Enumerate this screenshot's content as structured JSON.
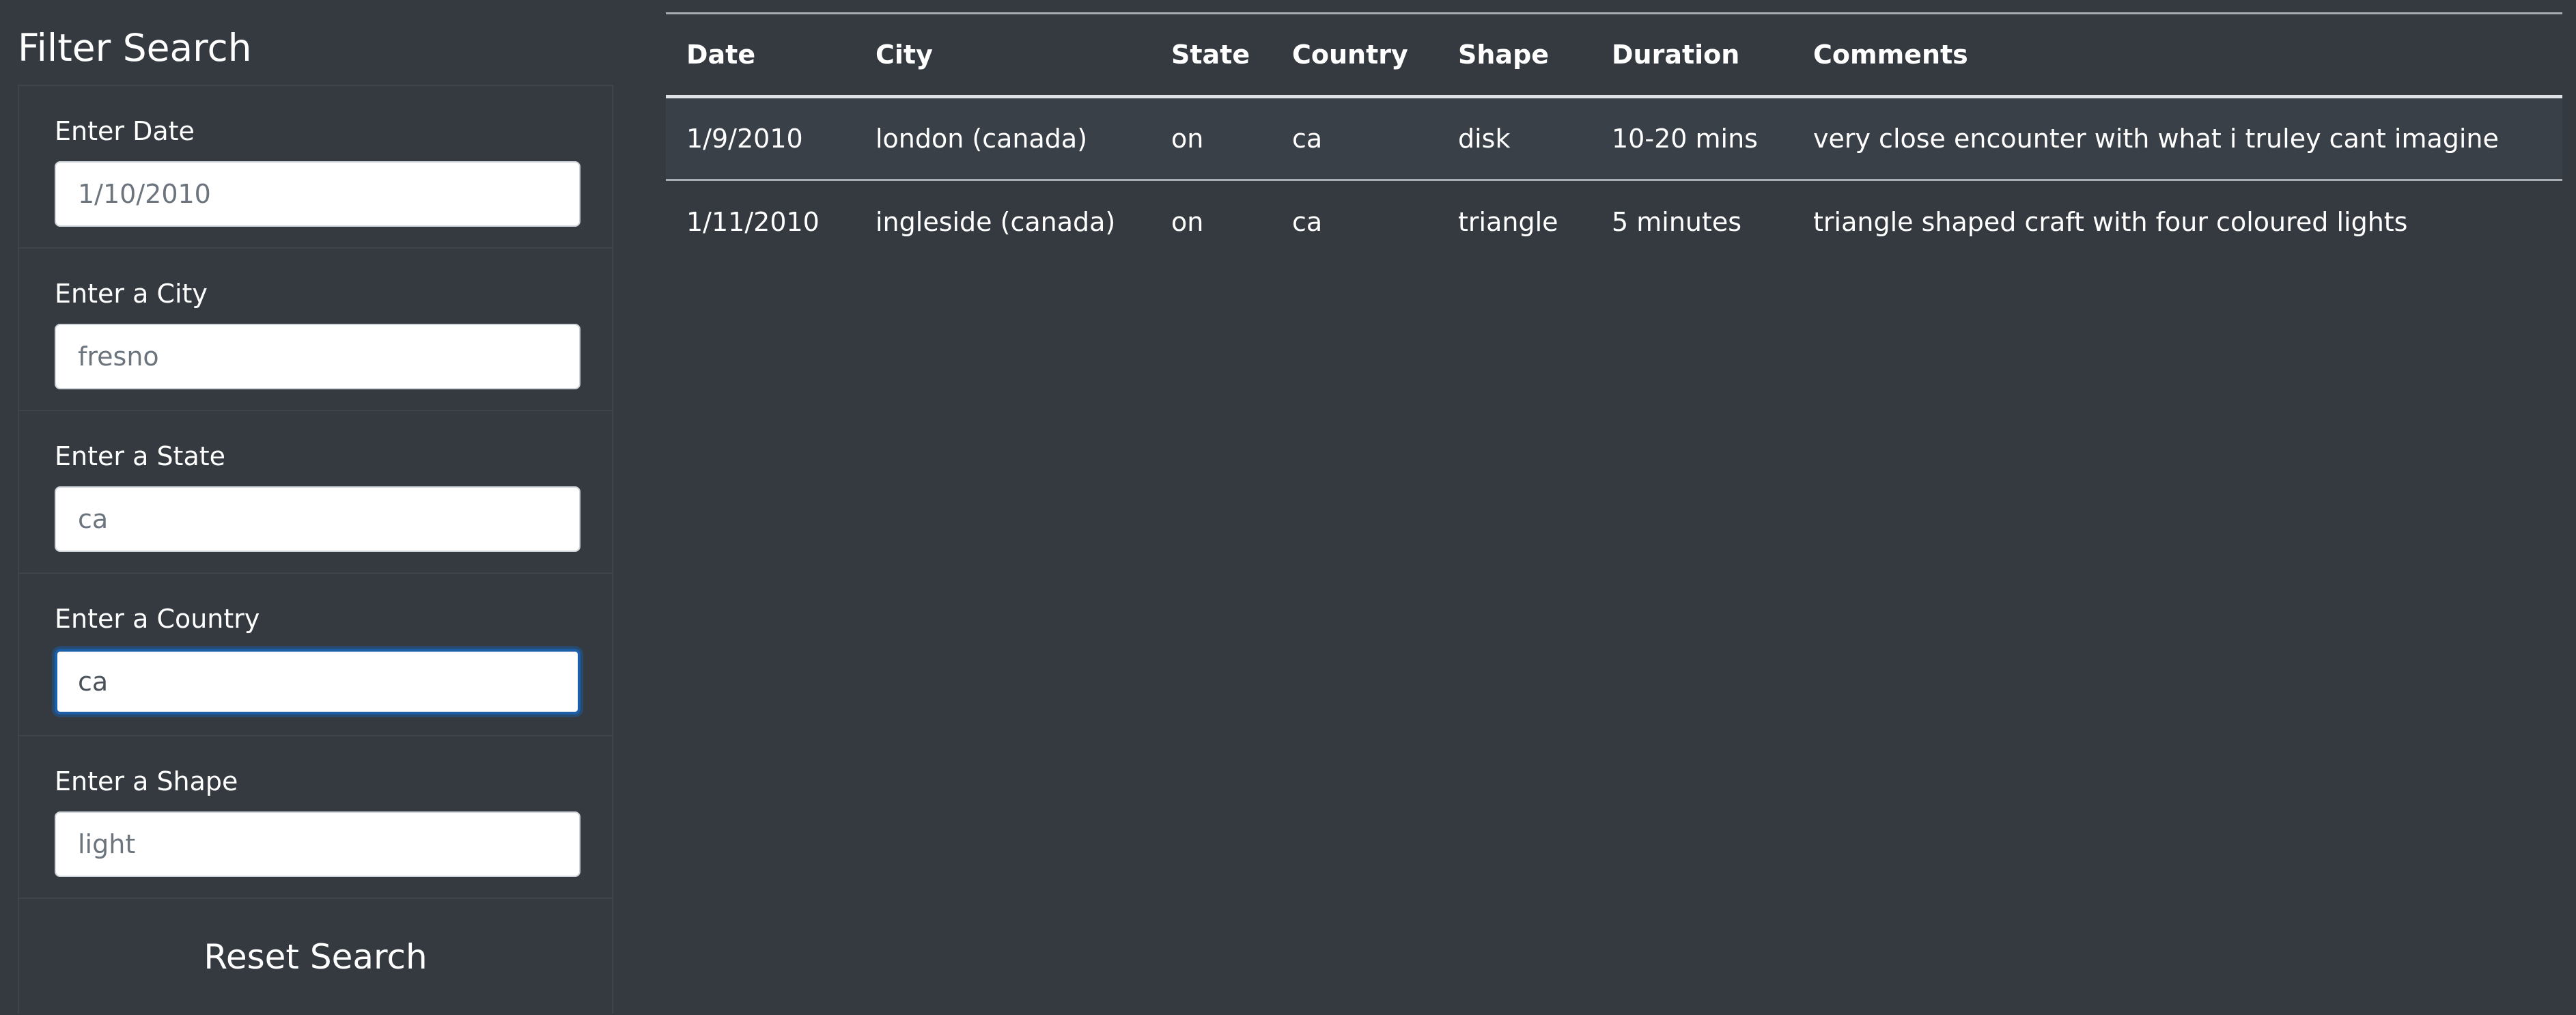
{
  "sidebar": {
    "title": "Filter Search",
    "filters": [
      {
        "label": "Enter Date",
        "placeholder": "1/10/2010",
        "value": ""
      },
      {
        "label": "Enter a City",
        "placeholder": "fresno",
        "value": ""
      },
      {
        "label": "Enter a State",
        "placeholder": "ca",
        "value": ""
      },
      {
        "label": "Enter a Country",
        "placeholder": "ca",
        "value": "ca"
      },
      {
        "label": "Enter a Shape",
        "placeholder": "light",
        "value": ""
      }
    ],
    "reset_label": "Reset Search"
  },
  "table": {
    "headers": [
      "Date",
      "City",
      "State",
      "Country",
      "Shape",
      "Duration",
      "Comments"
    ],
    "rows": [
      [
        "1/9/2010",
        "london (canada)",
        "on",
        "ca",
        "disk",
        "10-20 mins",
        "very close encounter with what i truley cant imagine"
      ],
      [
        "1/11/2010",
        "ingleside (canada)",
        "on",
        "ca",
        "triangle",
        "5 minutes",
        "triangle shaped craft with four coloured lights"
      ]
    ]
  },
  "colors": {
    "background": "#343a40",
    "focus_border": "#1d5ea8",
    "text": "#ffffff"
  }
}
